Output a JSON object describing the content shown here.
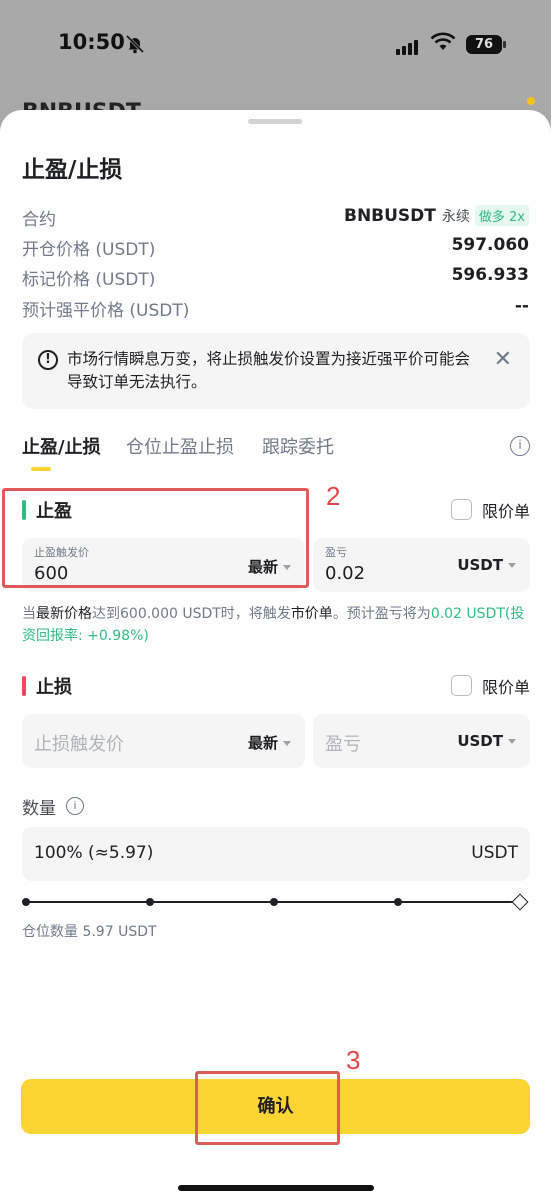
{
  "status_bar": {
    "time": "10:50",
    "battery": "76"
  },
  "background": {
    "title": "BNBUSDT"
  },
  "sheet": {
    "title": "止盈/止损",
    "info": {
      "contract_label": "合约",
      "contract_symbol": "BNBUSDT",
      "contract_type": "永续",
      "contract_badge": "做多 2x",
      "open_price_label": "开仓价格 (USDT)",
      "open_price": "597.060",
      "mark_price_label": "标记价格 (USDT)",
      "mark_price": "596.933",
      "liq_price_label": "预计强平价格 (USDT)",
      "liq_price": "--"
    },
    "alert": {
      "text": "市场行情瞬息万变，将止损触发价设置为接近强平价可能会导致订单无法执行。",
      "close_symbol": "✕"
    },
    "tabs": [
      "止盈/止损",
      "仓位止盈止损",
      "跟踪委托"
    ],
    "take_profit": {
      "title": "止盈",
      "limit_label": "限价单",
      "trigger_label": "止盈触发价",
      "trigger_value": "600",
      "trigger_type": "最新",
      "pnl_label": "盈亏",
      "pnl_value": "0.02",
      "pnl_unit": "USDT",
      "hint_1": "当",
      "hint_2": "最新价格",
      "hint_3": "达到600.000 USDT时，将触发",
      "hint_4": "市价单",
      "hint_5": "。预计盈亏将为",
      "hint_6": "0.02 USDT(投资回报率: +0.98%)"
    },
    "stop_loss": {
      "title": "止损",
      "limit_label": "限价单",
      "trigger_placeholder": "止损触发价",
      "trigger_type": "最新",
      "pnl_placeholder": "盈亏",
      "pnl_unit": "USDT"
    },
    "quantity": {
      "label": "数量",
      "value": "100% (≈5.97)",
      "unit": "USDT",
      "slider_percent": 100,
      "position_qty": "仓位数量 5.97 USDT"
    },
    "confirm_label": "确认"
  },
  "annotations": [
    "2",
    "3"
  ],
  "colors": {
    "accent": "#fcd535",
    "profit": "#2ebd85",
    "loss": "#f6465d",
    "annotation": "#e05a5a"
  }
}
